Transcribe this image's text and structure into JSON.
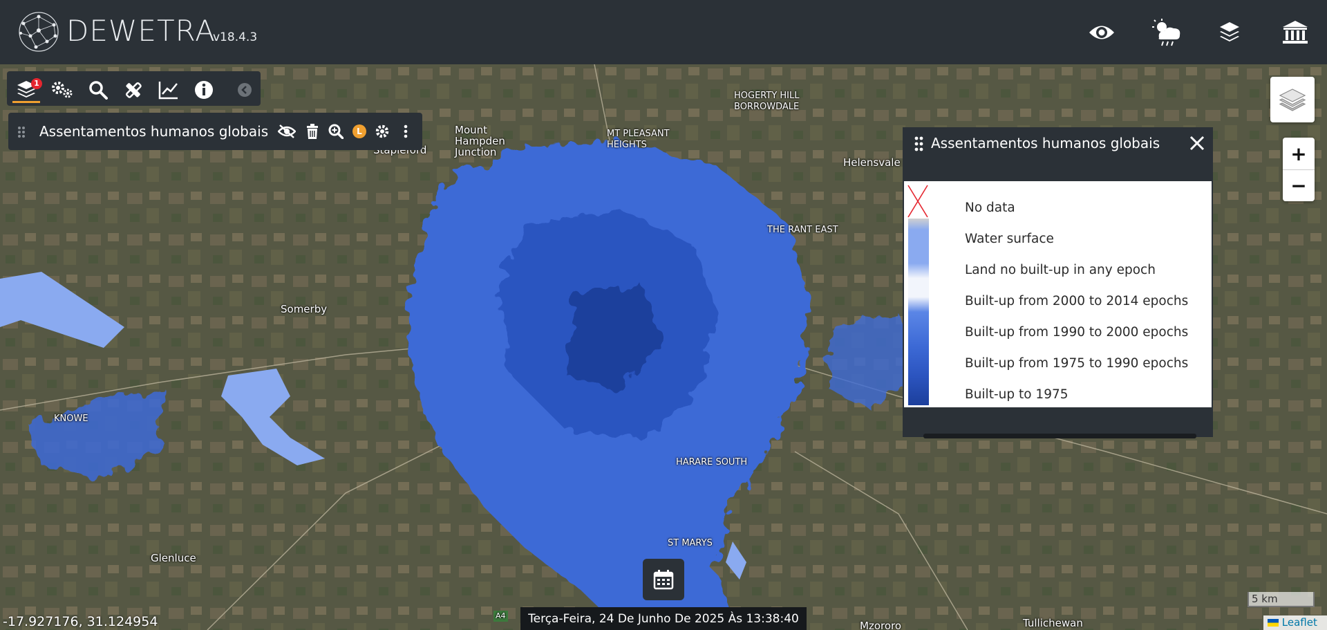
{
  "app": {
    "brand": "DEWETRA",
    "version": "v18.4.3"
  },
  "header": {
    "icons": [
      "eye-icon",
      "weather-icon",
      "layers-icon",
      "institution-icon"
    ]
  },
  "toolbar": {
    "layers_badge": "1",
    "buttons": [
      "layers-icon",
      "settings-icon",
      "search-icon",
      "tools-icon",
      "chart-icon",
      "info-icon",
      "collapse-icon"
    ]
  },
  "layer_row": {
    "name": "Assentamentos humanos globais",
    "badge": "L"
  },
  "legend": {
    "title": "Assentamentos humanos globais",
    "items": [
      {
        "label": "No data",
        "color": "no-data-cross"
      },
      {
        "label": "Water surface",
        "color": "#8aaaf0"
      },
      {
        "label": "Land no built-up in any epoch",
        "color": "#f2f5fc"
      },
      {
        "label": "Built-up from 2000 to 2014 epochs",
        "color": "#5b86e6"
      },
      {
        "label": "Built-up from 1990 to 2000 epochs",
        "color": "#3d6ad6"
      },
      {
        "label": "Built-up from 1975 to 1990 epochs",
        "color": "#2c55c0"
      },
      {
        "label": "Built-up to 1975",
        "color": "#1c3f9c"
      }
    ]
  },
  "map": {
    "places": [
      {
        "name": "Mount\nHampden\nJunction"
      },
      {
        "name": "Stapleford"
      },
      {
        "name": "MT PLEASANT\nHEIGHTS"
      },
      {
        "name": "HOGERTY HILL\nBORROWDALE"
      },
      {
        "name": "Helensvale"
      },
      {
        "name": "Somerby"
      },
      {
        "name": "KNOWE"
      },
      {
        "name": "HARARE SOUTH"
      },
      {
        "name": "ST MARYS"
      },
      {
        "name": "Glenluce"
      },
      {
        "name": "Tullichewan"
      },
      {
        "name": "Mzororo"
      },
      {
        "name": "THE RANT EAST"
      },
      {
        "name": "A4"
      }
    ]
  },
  "status": {
    "coordinates": "-17.927176, 31.124954",
    "datetime": "Terça-Feira, 24 De Junho De 2025 Às 13:38:40",
    "scale": "5 km",
    "attribution": "Leaflet"
  },
  "colors": {
    "panel_bg": "#2b3137",
    "accent": "#f0a030",
    "badge_red": "#e5262f",
    "built_up": "#3d6ad6"
  }
}
